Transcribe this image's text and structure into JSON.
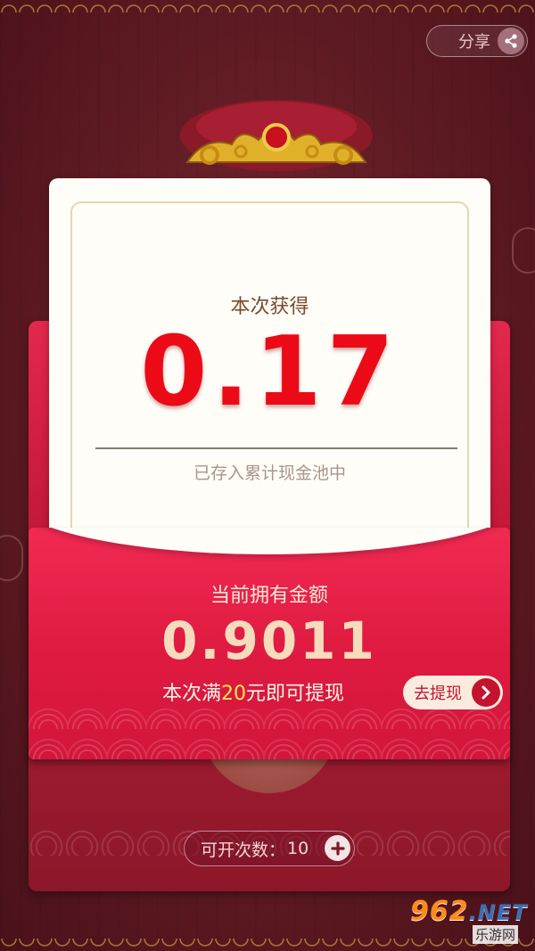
{
  "header": {
    "share_label": "分享"
  },
  "reward_card": {
    "title": "本次获得",
    "amount": "0.17",
    "note": "已存入累计现金池中"
  },
  "balance": {
    "label": "当前拥有金额",
    "amount": "0.9011",
    "tip_prefix": "本次满",
    "tip_threshold": "20",
    "tip_suffix": "元即可提现",
    "withdraw_label": "去提现"
  },
  "open_count": {
    "label": "可开次数：",
    "value": "10"
  },
  "watermark": {
    "brand_num": "962",
    "brand_net": ".NET",
    "sub": "乐游网"
  },
  "colors": {
    "background": "#5e1a22",
    "envelope_red": "#e2284d",
    "amount_red": "#ec0a17",
    "highlight_yellow": "#ffe35a",
    "gold": "#b88a3c"
  }
}
